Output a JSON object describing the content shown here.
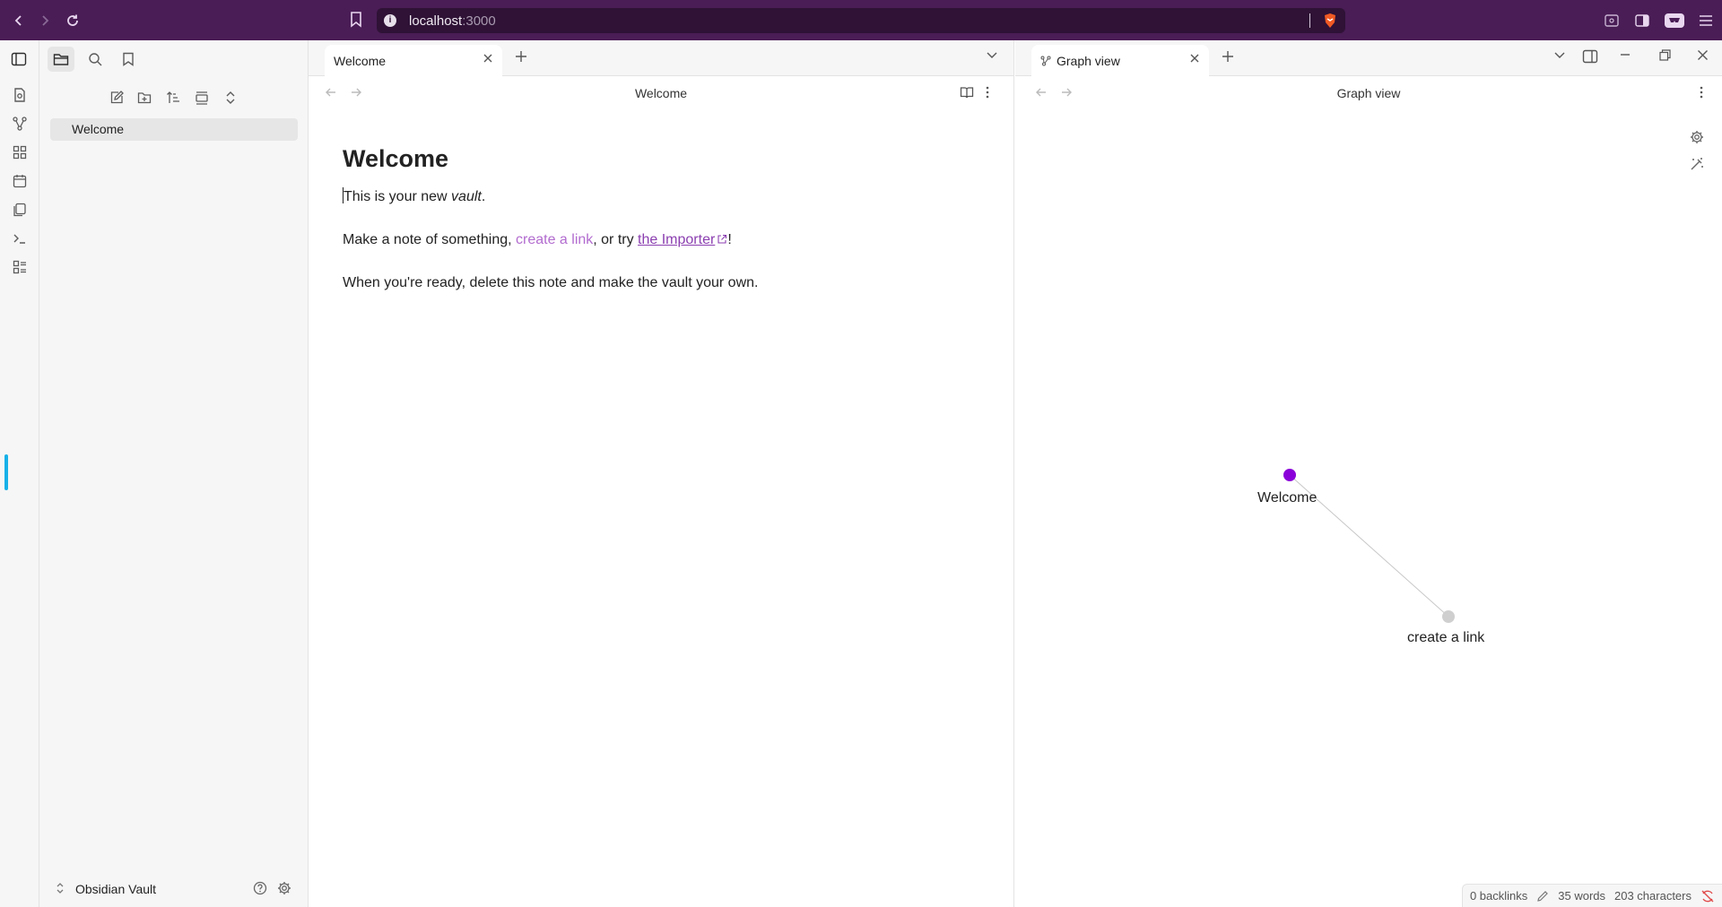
{
  "browser": {
    "url_host": "localhost",
    "url_port": ":3000",
    "info_icon": "i"
  },
  "sidebar": {
    "files": [
      {
        "label": "Welcome"
      }
    ],
    "vault_name": "Obsidian Vault"
  },
  "editor": {
    "tab_title": "Welcome",
    "header_title": "Welcome",
    "heading": "Welcome",
    "p1_prefix": "This is your new ",
    "p1_em": "vault",
    "p1_suffix": ".",
    "p2_prefix": "Make a note of something, ",
    "p2_link": "create a link",
    "p2_middle": ", or try ",
    "p2_external": "the Importer",
    "p2_suffix": "!",
    "p3": "When you're ready, delete this note and make the vault your own."
  },
  "graph": {
    "tab_title": "Graph view",
    "header_title": "Graph view",
    "nodes": [
      {
        "label": "Welcome",
        "color": "#8a00d9"
      },
      {
        "label": "create a link",
        "color": "#cfcfcf"
      }
    ]
  },
  "status": {
    "backlinks": "0 backlinks",
    "words": "35 words",
    "characters": "203 characters"
  },
  "colors": {
    "browser_bar": "#4a1d56",
    "accent": "#8a00d9",
    "link": "#b26ccf"
  }
}
